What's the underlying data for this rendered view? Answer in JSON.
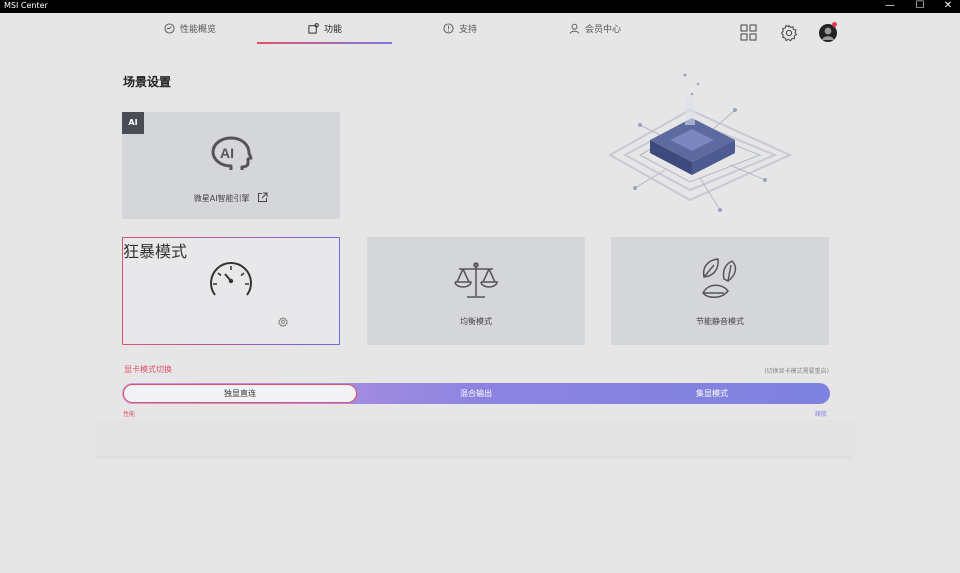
{
  "window": {
    "title": "MSI Center",
    "minimize": "—",
    "maximize": "☐",
    "close": "✕"
  },
  "nav": {
    "tabs": [
      {
        "label": "性能概览",
        "icon": "gauge-icon"
      },
      {
        "label": "功能",
        "icon": "features-icon"
      },
      {
        "label": "支持",
        "icon": "support-icon"
      },
      {
        "label": "会员中心",
        "icon": "user-icon"
      }
    ],
    "active_index": 1,
    "right_icons": [
      "grid-icon",
      "settings-icon",
      "avatar"
    ]
  },
  "page": {
    "title": "场景设置"
  },
  "ai_card": {
    "badge": "AI",
    "label": "微星AI智能引擎",
    "icon": "ai-head-icon",
    "link_icon": "external-link-icon"
  },
  "mode_cards": [
    {
      "label": "狂暴模式",
      "icon": "speedometer-icon",
      "selected": true,
      "has_settings": true
    },
    {
      "label": "均衡模式",
      "icon": "balance-scale-icon",
      "selected": false
    },
    {
      "label": "节能静音模式",
      "icon": "leaf-icon",
      "selected": false
    }
  ],
  "gpu_switch": {
    "title": "显卡模式切换",
    "note": "(切换显卡模式需要重启)",
    "options": [
      "独显直连",
      "混合输出",
      "集显模式"
    ],
    "selected_index": 0,
    "left_caption": "性能",
    "right_caption": "续航"
  },
  "colors": {
    "accent_red": "#e0526b",
    "accent_blue": "#7d78e0",
    "background": "#e6e6e6",
    "card": "#d5d6d9"
  }
}
